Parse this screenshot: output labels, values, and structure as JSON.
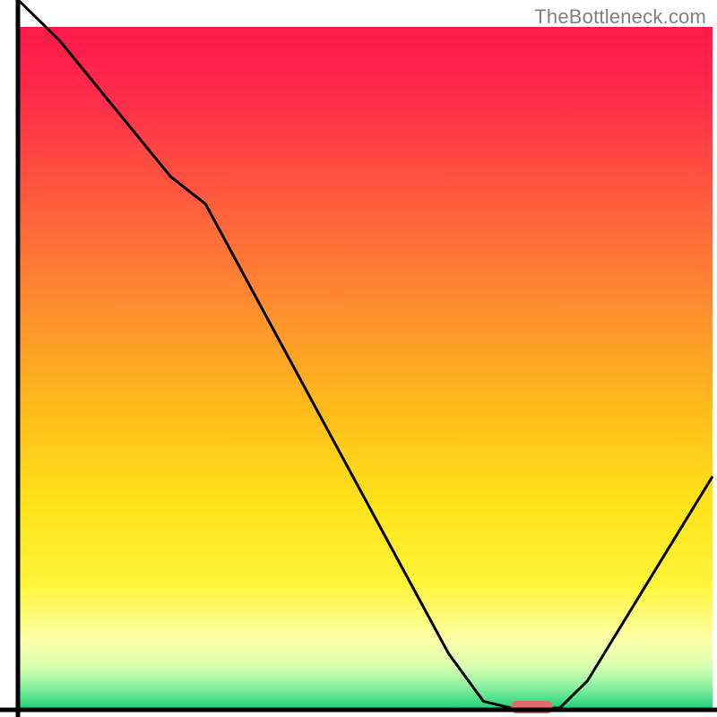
{
  "watermark": "TheBottleneck.com",
  "chart_data": {
    "type": "line",
    "title": "",
    "xlabel": "",
    "ylabel": "",
    "xlim": [
      0,
      100
    ],
    "ylim": [
      0,
      100
    ],
    "x": [
      0,
      6,
      22,
      27,
      62,
      67,
      71,
      78,
      82,
      100
    ],
    "values": [
      104,
      98,
      78,
      74,
      8,
      1,
      0,
      0,
      4,
      34
    ],
    "annotations": [],
    "gradient_stops": [
      {
        "offset": 0.0,
        "color": "#ff1a4a"
      },
      {
        "offset": 0.1,
        "color": "#ff2a4a"
      },
      {
        "offset": 0.25,
        "color": "#ff5a3e"
      },
      {
        "offset": 0.4,
        "color": "#ff8a30"
      },
      {
        "offset": 0.55,
        "color": "#ffb81c"
      },
      {
        "offset": 0.7,
        "color": "#ffe31a"
      },
      {
        "offset": 0.82,
        "color": "#fff53a"
      },
      {
        "offset": 0.9,
        "color": "#fdffa8"
      },
      {
        "offset": 0.94,
        "color": "#d6ffb0"
      },
      {
        "offset": 0.97,
        "color": "#88f0a0"
      },
      {
        "offset": 1.0,
        "color": "#20d37a"
      }
    ],
    "marker": {
      "x": 74,
      "y": 0,
      "width": 6,
      "height": 2,
      "color": "#e56a6a"
    },
    "axes": {
      "left": {
        "x": 2,
        "y1": 0,
        "y2": 100
      },
      "bottom": {
        "y": 0,
        "x1": 0,
        "x2": 100
      }
    }
  }
}
